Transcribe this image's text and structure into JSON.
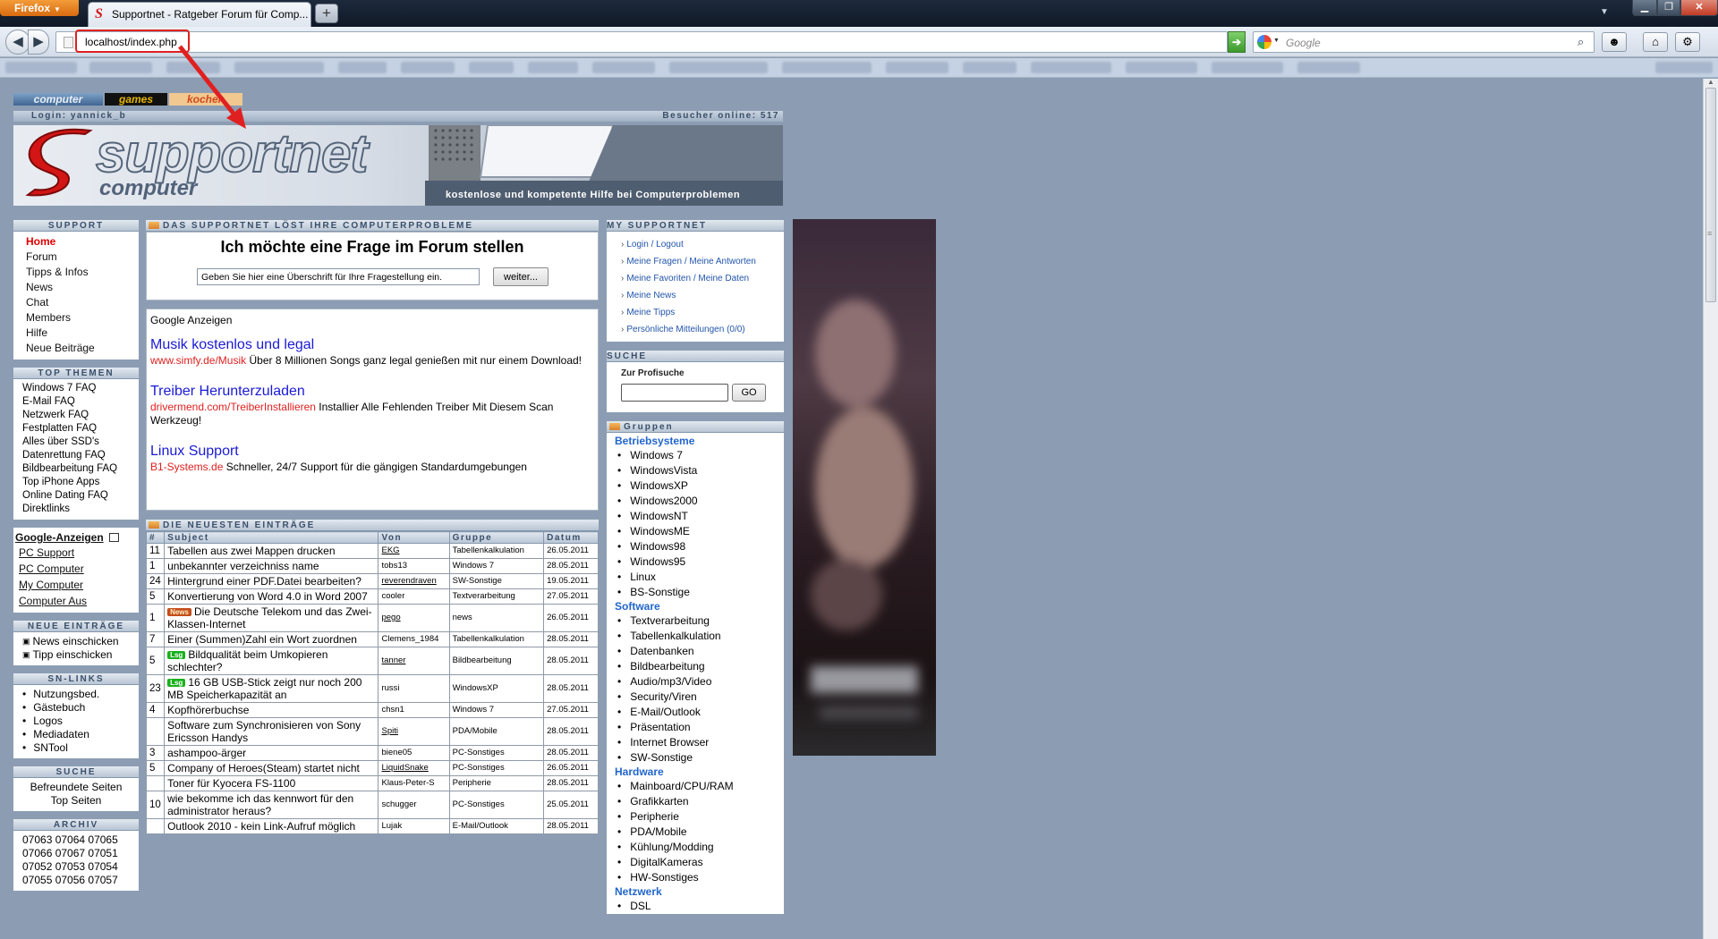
{
  "browser": {
    "menu_button": "Firefox",
    "tab_title": "Supportnet - Ratgeber Forum für Comp...",
    "new_tab": "+",
    "url": "localhost/index.php",
    "search_placeholder": "Google"
  },
  "site": {
    "tabs": [
      "computer",
      "games",
      "kochen"
    ],
    "login": "Login: yannick_b",
    "visitors": "Besucher online: 517",
    "banner_title": "supportnet",
    "banner_subtitle": "computer",
    "banner_tagline": "kostenlose und kompetente Hilfe bei Computerproblemen"
  },
  "left": {
    "support": {
      "title": "SUPPORT",
      "items": [
        "Home",
        "Forum",
        "Tipps & Infos",
        "News",
        "Chat",
        "Members",
        "Hilfe",
        "Neue Beiträge"
      ]
    },
    "top_themen": {
      "title": "TOP THEMEN",
      "items": [
        "Windows 7 FAQ",
        "E-Mail FAQ",
        "Netzwerk FAQ",
        "Festplatten FAQ",
        "Alles über SSD's",
        "Datenrettung FAQ",
        "Bildbearbeitung FAQ",
        "Top iPhone Apps",
        "Online Dating FAQ",
        "Direktlinks"
      ]
    },
    "google_anzeigen": {
      "title": "Google-Anzeigen",
      "items": [
        "PC Support",
        "PC Computer",
        "My Computer",
        "Computer Aus"
      ]
    },
    "neue_eintraege": {
      "title": "Neue Einträge",
      "items": [
        "News einschicken",
        "Tipp einschicken"
      ]
    },
    "sn_links": {
      "title": "SN-LINKS",
      "items": [
        "Nutzungsbed.",
        "Gästebuch",
        "Logos",
        "Mediadaten",
        "SNTool"
      ]
    },
    "suche": {
      "title": "Suche",
      "items": [
        "Befreundete Seiten",
        "Top Seiten"
      ]
    },
    "archiv": {
      "title": "ARCHIV",
      "rows": [
        "07063 07064 07065",
        "07066 07067 07051",
        "07052 07053 07054",
        "07055 07056 07057"
      ]
    }
  },
  "center": {
    "ask": {
      "header": "Das Supportnet löst Ihre Computerprobleme",
      "title": "Ich möchte eine Frage im Forum stellen",
      "input_value": "Geben Sie hier eine Überschrift für Ihre Fragestellung ein.",
      "button": "weiter..."
    },
    "ads": {
      "label": "Google Anzeigen",
      "items": [
        {
          "title": "Musik kostenlos und legal",
          "url": "www.simfy.de/Musik",
          "text": " Über 8 Millionen Songs ganz legal genießen mit nur einem Download!"
        },
        {
          "title": "Treiber Herunterzuladen",
          "url": "drivermend.com/TreiberInstallieren",
          "text": " Installier Alle Fehlenden Treiber Mit Diesem Scan Werkzeug!"
        },
        {
          "title": "Linux Support",
          "url": "B1-Systems.de",
          "text": " Schneller, 24/7 Support für die gängigen Standardumgebungen"
        }
      ]
    },
    "entries": {
      "header": "Die neuesten Einträge",
      "columns": [
        "#",
        "Subject",
        "Von",
        "Gruppe",
        "Datum"
      ],
      "rows": [
        {
          "n": "11",
          "badge": "",
          "subject": "Tabellen aus zwei Mappen drucken",
          "von": "EKG",
          "von_link": true,
          "gruppe": "Tabellenkalkulation",
          "datum": "26.05.2011"
        },
        {
          "n": "1",
          "badge": "",
          "subject": "unbekannter verzeichniss name",
          "von": "tobs13",
          "von_link": false,
          "gruppe": "Windows 7",
          "datum": "28.05.2011"
        },
        {
          "n": "24",
          "badge": "",
          "subject": "Hintergrund einer PDF.Datei bearbeiten?",
          "von": "reverendraven",
          "von_link": true,
          "gruppe": "SW-Sonstige",
          "datum": "19.05.2011"
        },
        {
          "n": "5",
          "badge": "",
          "subject": "Konvertierung von Word 4.0 in Word 2007",
          "von": "cooler",
          "von_link": false,
          "gruppe": "Textverarbeitung",
          "datum": "27.05.2011"
        },
        {
          "n": "1",
          "badge": "News",
          "subject": "Die Deutsche Telekom und das Zwei-Klassen-Internet",
          "von": "pego",
          "von_link": true,
          "gruppe": "news",
          "datum": "26.05.2011"
        },
        {
          "n": "7",
          "badge": "",
          "subject": "Einer (Summen)Zahl ein Wort zuordnen",
          "von": "Clemens_1984",
          "von_link": false,
          "gruppe": "Tabellenkalkulation",
          "datum": "28.05.2011"
        },
        {
          "n": "5",
          "badge": "Lsg",
          "subject": "Bildqualität beim Umkopieren schlechter?",
          "von": "tanner",
          "von_link": true,
          "gruppe": "Bildbearbeitung",
          "datum": "28.05.2011"
        },
        {
          "n": "23",
          "badge": "Lsg",
          "subject": "16 GB USB-Stick zeigt nur noch 200 MB Speicherkapazität an",
          "von": "russi",
          "von_link": false,
          "gruppe": "WindowsXP",
          "datum": "28.05.2011"
        },
        {
          "n": "4",
          "badge": "",
          "subject": "Kopfhörerbuchse",
          "von": "chsn1",
          "von_link": false,
          "gruppe": "Windows 7",
          "datum": "27.05.2011"
        },
        {
          "n": "",
          "badge": "",
          "subject": "Software zum Synchronisieren von Sony Ericsson Handys",
          "von": "Spiti",
          "von_link": true,
          "gruppe": "PDA/Mobile",
          "datum": "28.05.2011"
        },
        {
          "n": "3",
          "badge": "",
          "subject": "ashampoo-ärger",
          "von": "biene05",
          "von_link": false,
          "gruppe": "PC-Sonstiges",
          "datum": "28.05.2011"
        },
        {
          "n": "5",
          "badge": "",
          "subject": "Company of Heroes(Steam) startet nicht",
          "von": "LiquidSnake",
          "von_link": true,
          "gruppe": "PC-Sonstiges",
          "datum": "26.05.2011"
        },
        {
          "n": "",
          "badge": "",
          "subject": "Toner für Kyocera FS-1100",
          "von": "Klaus-Peter-S",
          "von_link": false,
          "gruppe": "Peripherie",
          "datum": "28.05.2011"
        },
        {
          "n": "10",
          "badge": "",
          "subject": "wie bekomme ich das kennwort für den administrator heraus?",
          "von": "schugger",
          "von_link": false,
          "gruppe": "PC-Sonstiges",
          "datum": "25.05.2011"
        },
        {
          "n": "",
          "badge": "",
          "subject": "Outlook 2010 - kein Link-Aufruf möglich",
          "von": "Lujak",
          "von_link": false,
          "gruppe": "E-Mail/Outlook",
          "datum": "28.05.2011"
        }
      ]
    }
  },
  "right": {
    "my_supportnet": {
      "title": "My Supportnet",
      "items": [
        "Login / Logout",
        "Meine Fragen / Meine Antworten",
        "Meine Favoriten / Meine Daten",
        "Meine News",
        "Meine Tipps",
        "Persönliche Mitteilungen (0/0)"
      ]
    },
    "suche": {
      "title": "SUCHE",
      "label": "Zur Profisuche",
      "button": "GO"
    },
    "gruppen": {
      "title": "Gruppen",
      "categories": [
        {
          "name": "Betriebsysteme",
          "items": [
            "Windows 7",
            "WindowsVista",
            "WindowsXP",
            "Windows2000",
            "WindowsNT",
            "WindowsME",
            "Windows98",
            "Windows95",
            "Linux",
            "BS-Sonstige"
          ]
        },
        {
          "name": "Software",
          "items": [
            "Textverarbeitung",
            "Tabellenkalkulation",
            "Datenbanken",
            "Bildbearbeitung",
            "Audio/mp3/Video",
            "Security/Viren",
            "E-Mail/Outlook",
            "Präsentation",
            "Internet Browser",
            "SW-Sonstige"
          ]
        },
        {
          "name": "Hardware",
          "items": [
            "Mainboard/CPU/RAM",
            "Grafikkarten",
            "Peripherie",
            "PDA/Mobile",
            "Kühlung/Modding",
            "DigitalKameras",
            "HW-Sonstiges"
          ]
        },
        {
          "name": "Netzwerk",
          "items": [
            "DSL"
          ]
        }
      ]
    }
  },
  "colors": {
    "page_bg": "#8c9db3",
    "accent_red": "#e00000",
    "ad_link": "#1a1ad6",
    "group_heading": "#2266cc"
  }
}
